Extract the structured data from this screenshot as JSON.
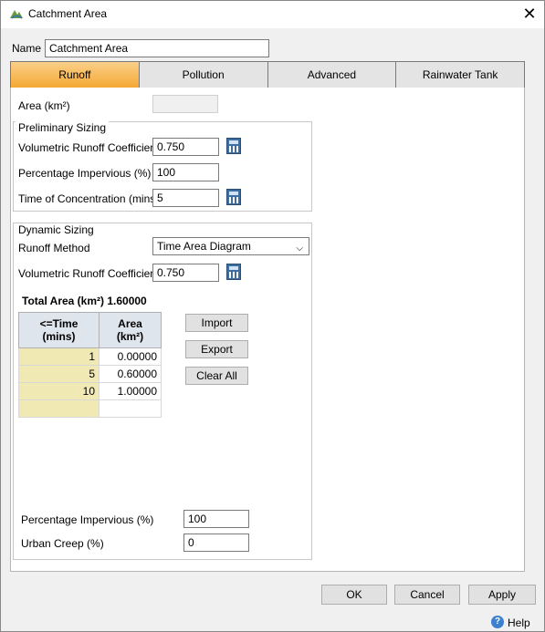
{
  "window": {
    "title": "Catchment Area",
    "close_glyph": "✕"
  },
  "name_field": {
    "label": "Name",
    "value": "Catchment Area"
  },
  "tabs": [
    {
      "label": "Runoff",
      "active": true
    },
    {
      "label": "Pollution",
      "active": false
    },
    {
      "label": "Advanced",
      "active": false
    },
    {
      "label": "Rainwater Tank",
      "active": false
    }
  ],
  "area": {
    "label": "Area (km²)",
    "value": ""
  },
  "preliminary": {
    "legend": "Preliminary Sizing",
    "vrc_label": "Volumetric Runoff Coefficient",
    "vrc_value": "0.750",
    "pi_label": "Percentage Impervious (%)",
    "pi_value": "100",
    "toc_label": "Time of Concentration (mins)",
    "toc_value": "5"
  },
  "dynamic": {
    "legend": "Dynamic Sizing",
    "method_label": "Runoff Method",
    "method_value": "Time Area Diagram",
    "vrc_label": "Volumetric Runoff Coefficient",
    "vrc_value": "0.750",
    "total_area": "Total Area (km²) 1.60000",
    "table": {
      "headers": [
        "<=Time (mins)",
        "Area (km²)"
      ],
      "rows": [
        [
          "1",
          "0.00000"
        ],
        [
          "5",
          "0.60000"
        ],
        [
          "10",
          "1.00000"
        ],
        [
          "",
          ""
        ]
      ]
    },
    "import_label": "Import",
    "export_label": "Export",
    "clear_label": "Clear All",
    "pi_label": "Percentage Impervious (%)",
    "pi_value": "100",
    "creep_label": "Urban Creep (%)",
    "creep_value": "0"
  },
  "footer": {
    "ok": "OK",
    "cancel": "Cancel",
    "apply": "Apply",
    "help": "Help"
  },
  "colors": {
    "active_tab": "#f5a833",
    "key_column": "#f1e9b3",
    "calc_icon": "#3d6fa3"
  }
}
